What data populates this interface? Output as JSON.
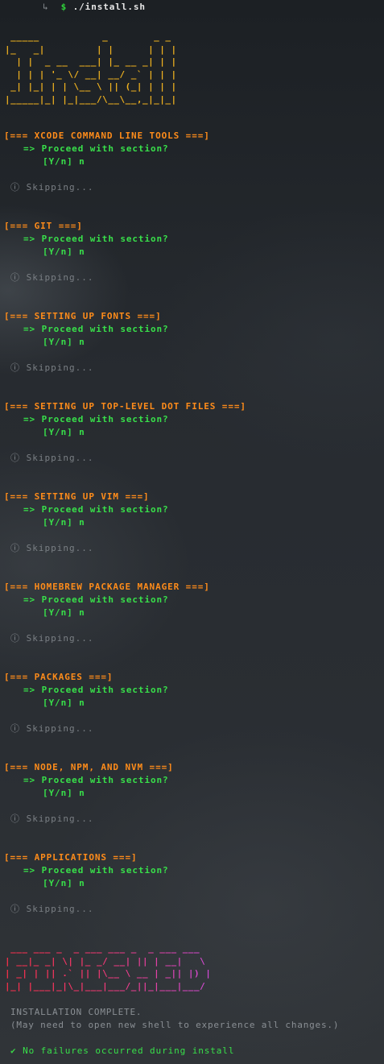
{
  "prompt": {
    "arrow": "↳",
    "dollar": "$",
    "command": "./install.sh"
  },
  "banner_ascii": " _____           _        _ _ \n|_   _|         | |      | | |\n  | |  _ __  ___| |_ __ _| | |\n  | | | '_ \\/ __| __/ _` | | |\n _| |_| | | \\__ \\ || (_| | | |\n|_____|_| |_|___/\\__\\__,_|_|_|",
  "sections": [
    {
      "header": "[=== XCODE COMMAND LINE TOOLS ===]",
      "proceed": "=> Proceed with section?",
      "yn": "[Y/n] n",
      "skip_icon": "info-icon",
      "skip_symbol": "ⓘ",
      "skip_text": "Skipping..."
    },
    {
      "header": "[=== GIT ===]",
      "proceed": "=> Proceed with section?",
      "yn": "[Y/n] n",
      "skip_icon": "info-icon",
      "skip_symbol": "ⓘ",
      "skip_text": "Skipping..."
    },
    {
      "header": "[=== SETTING UP FONTS ===]",
      "proceed": "=> Proceed with section?",
      "yn": "[Y/n] n",
      "skip_icon": "info-icon",
      "skip_symbol": "ⓘ",
      "skip_text": "Skipping..."
    },
    {
      "header": "[=== SETTING UP TOP-LEVEL DOT FILES ===]",
      "proceed": "=> Proceed with section?",
      "yn": "[Y/n] n",
      "skip_icon": "info-icon",
      "skip_symbol": "ⓘ",
      "skip_text": "Skipping..."
    },
    {
      "header": "[=== SETTING UP VIM ===]",
      "proceed": "=> Proceed with section?",
      "yn": "[Y/n] n",
      "skip_icon": "info-icon",
      "skip_symbol": "ⓘ",
      "skip_text": "Skipping..."
    },
    {
      "header": "[=== HOMEBREW PACKAGE MANAGER ===]",
      "proceed": "=> Proceed with section?",
      "yn": "[Y/n] n",
      "skip_icon": "info-icon",
      "skip_symbol": "ⓘ",
      "skip_text": "Skipping..."
    },
    {
      "header": "[=== PACKAGES ===]",
      "proceed": "=> Proceed with section?",
      "yn": "[Y/n] n",
      "skip_icon": "info-icon",
      "skip_symbol": "ⓘ",
      "skip_text": "Skipping..."
    },
    {
      "header": "[=== NODE, NPM, AND NVM ===]",
      "proceed": "=> Proceed with section?",
      "yn": "[Y/n] n",
      "skip_icon": "info-icon",
      "skip_symbol": "ⓘ",
      "skip_text": "Skipping..."
    },
    {
      "header": "[=== APPLICATIONS ===]",
      "proceed": "=> Proceed with section?",
      "yn": "[Y/n] n",
      "skip_icon": "info-icon",
      "skip_symbol": "ⓘ",
      "skip_text": "Skipping..."
    }
  ],
  "finished_ascii": " ___ ___ _  _ ___ ___ _  _ ___ ___  \n| __|_ _| \\| |_ _/ __| || | __|   \\ \n| _| | || .` || |\\__ \\ __ | _|| |) |\n|_| |___|_|\\_|___|___/_||_|___|___/ ",
  "complete": {
    "line1": "INSTALLATION COMPLETE.",
    "line2": "(May need to open new shell to experience all changes.)"
  },
  "success": {
    "icon": "check-icon",
    "symbol": "✔",
    "text": "No failures occurred during install"
  },
  "colors": {
    "section_header": "#ff8c1a",
    "prompt_green": "#38e04a",
    "banner_orange": "#f0b21f",
    "finished_pink": "#f0386a",
    "muted_gray": "#7a7f84"
  }
}
